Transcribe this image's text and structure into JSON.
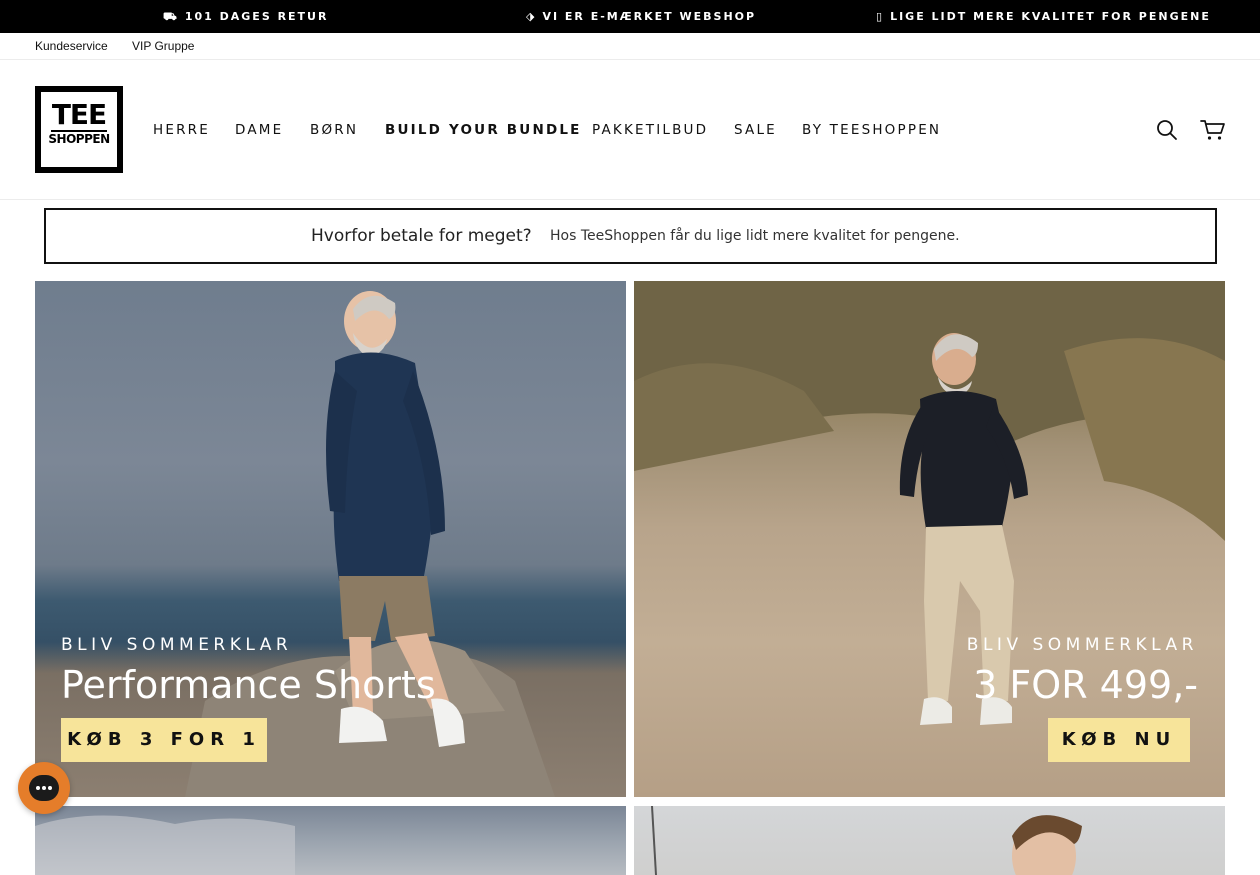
{
  "announcement": [
    {
      "icon": "truck-icon",
      "glyph": "⛟",
      "text": "101 DAGES RETUR"
    },
    {
      "icon": "emark-icon",
      "glyph": "⬗",
      "text": "VI ER E-MÆRKET WEBSHOP"
    },
    {
      "icon": "unknown-glyph-icon",
      "glyph": "▯",
      "text": "LIGE LIDT MERE KVALITET FOR PENGENE"
    }
  ],
  "utility_links": [
    "Kundeservice",
    "VIP Gruppe"
  ],
  "logo": {
    "line1": "TEE",
    "line2": "SHOPPEN"
  },
  "nav": [
    "HERRE",
    "DAME",
    "BØRN",
    "BUILD YOUR BUNDLE",
    "PAKKETILBUD",
    "SALE",
    "BY TEESHOPPEN"
  ],
  "header_icons": {
    "search": "search-icon",
    "cart": "cart-icon"
  },
  "notice": {
    "heading": "Hvorfor betale for meget?",
    "text": "Hos TeeShoppen får du lige lidt mere kvalitet for pengene."
  },
  "tiles": [
    {
      "eyebrow": "BLIV SOMMERKLAR",
      "title": "Performance Shorts",
      "cta": "KØB 3 FOR 1"
    },
    {
      "eyebrow": "BLIV SOMMERKLAR",
      "title": "3 FOR 499,-",
      "cta": "KØB NU"
    }
  ],
  "colors": {
    "accent_button": "#f7e49a",
    "chat_bubble": "#e57d2a",
    "top_bar": "#000000"
  }
}
